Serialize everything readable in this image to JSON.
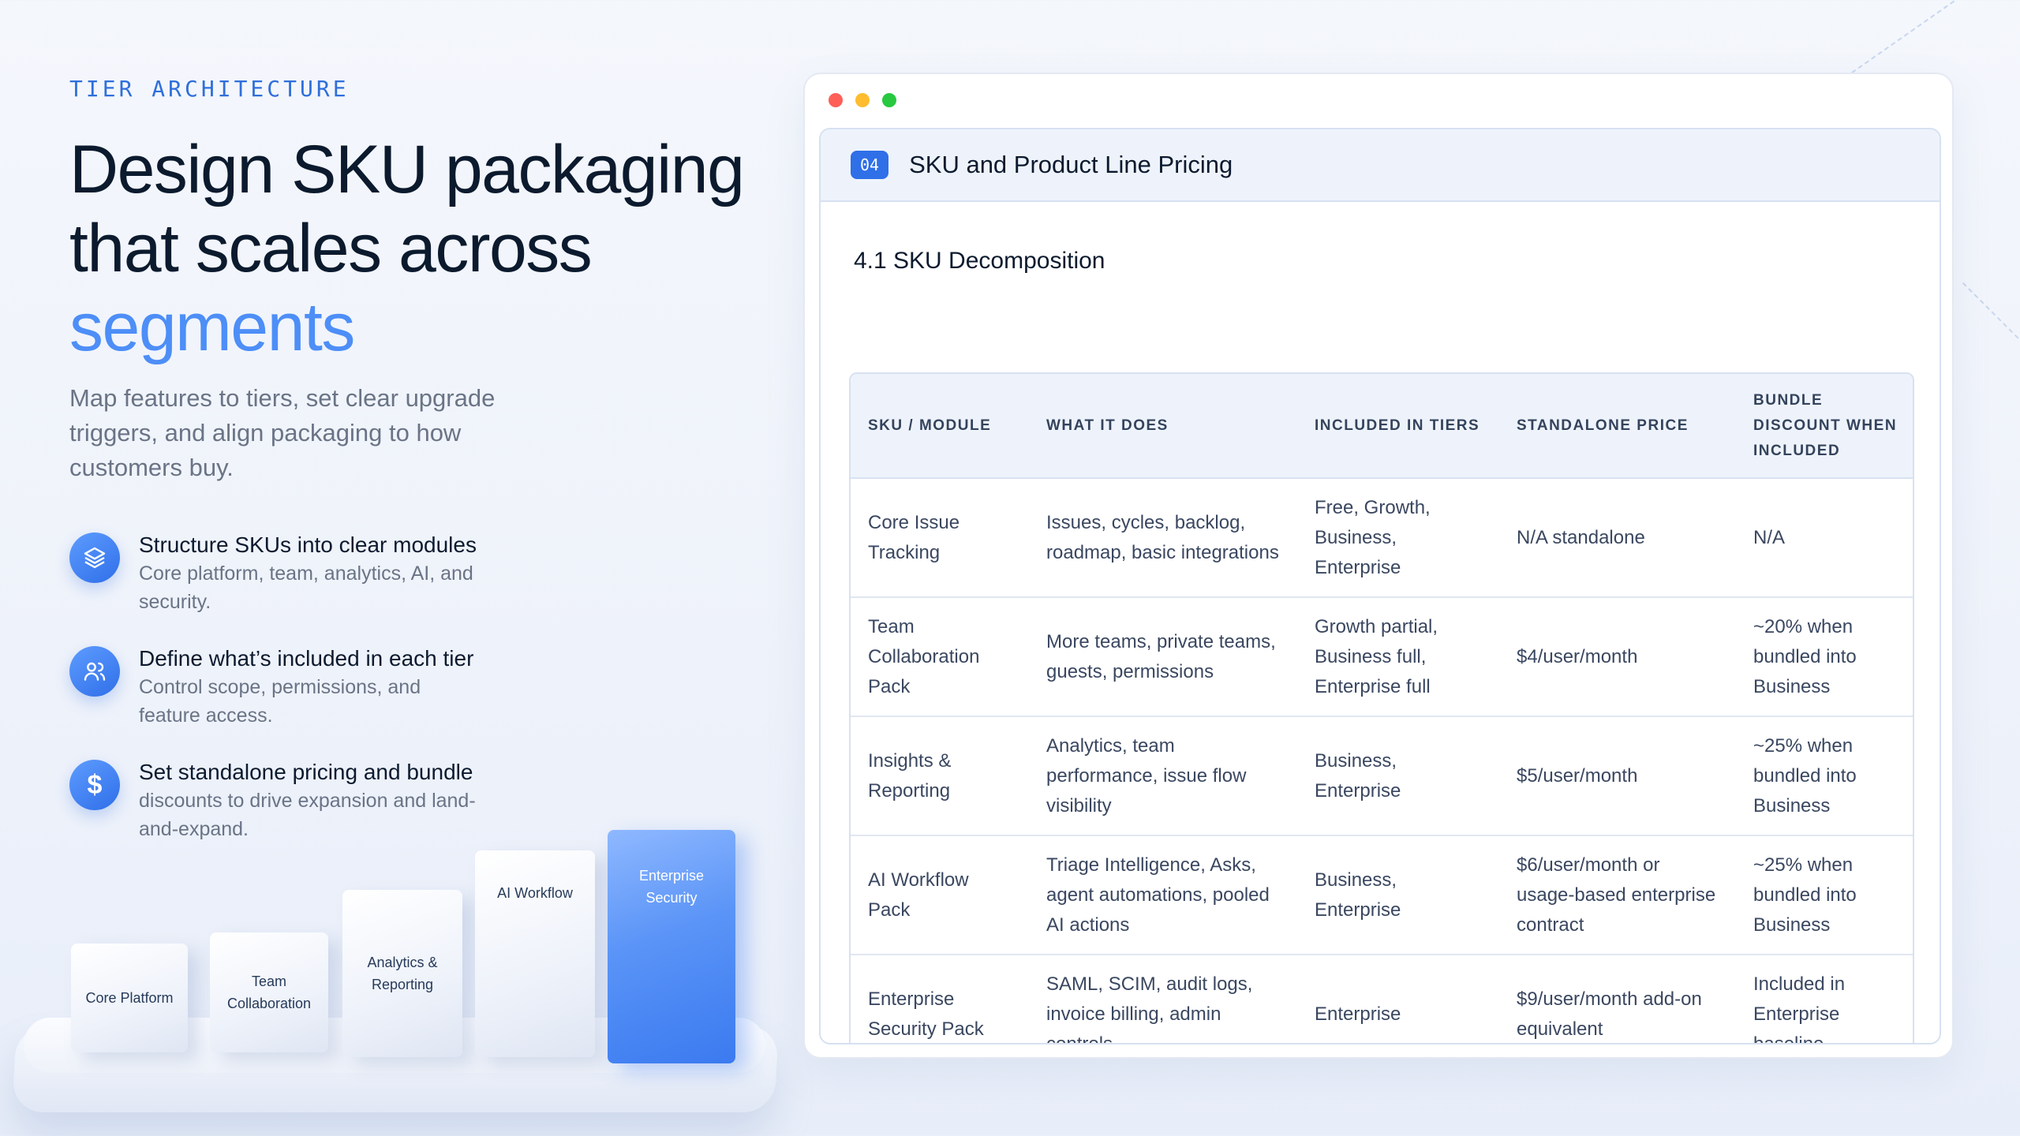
{
  "hero": {
    "eyebrow": "TIER ARCHITECTURE",
    "headline_line1": "Design SKU packaging",
    "headline_line2": "that scales across",
    "headline_accent": "segments",
    "subhead": "Map features to tiers, set clear upgrade triggers, and align packaging to how customers buy."
  },
  "features": [
    {
      "icon": "layers-icon",
      "title": "Structure SKUs into clear modules",
      "desc": "Core platform, team, analytics, AI, and security."
    },
    {
      "icon": "users-icon",
      "title": "Define what’s included in each tier",
      "desc": "Control scope, permissions, and feature access."
    },
    {
      "icon": "dollar-icon",
      "symbol": "$",
      "title": "Set standalone pricing and bundle",
      "desc": "discounts to drive expansion and land-and-expand."
    }
  ],
  "blocks": [
    "Core Platform",
    "Team Collaboration",
    "Analytics & Reporting",
    "AI Workflow",
    "Enterprise Security"
  ],
  "window": {
    "badge": "04",
    "title": "SKU and Product Line Pricing",
    "section": "4.1 SKU Decomposition",
    "dot_colors": [
      "#ff5f57",
      "#febc2e",
      "#28c840"
    ],
    "columns": [
      "SKU / MODULE",
      "WHAT IT DOES",
      "INCLUDED IN TIERS",
      "STANDALONE PRICE",
      "BUNDLE DISCOUNT WHEN INCLUDED"
    ],
    "rows": [
      [
        "Core Issue Tracking",
        "Issues, cycles, backlog, roadmap, basic integrations",
        "Free, Growth, Business, Enterprise",
        "N/A standalone",
        "N/A"
      ],
      [
        "Team Collaboration Pack",
        "More teams, private teams, guests, permissions",
        "Growth partial, Business full, Enterprise full",
        "$4/user/month",
        "~20% when bundled into Business"
      ],
      [
        "Insights & Reporting",
        "Analytics, team performance, issue flow visibility",
        "Business, Enterprise",
        "$5/user/month",
        "~25% when bundled into Business"
      ],
      [
        "AI Workflow Pack",
        "Triage Intelligence, Asks, agent automations, pooled AI actions",
        "Business, Enterprise",
        "$6/user/month or usage-based enterprise contract",
        "~25% when bundled into Business"
      ],
      [
        "Enterprise Security Pack",
        "SAML, SCIM, audit logs, invoice billing, admin controls",
        "Enterprise",
        "$9/user/month add-on equivalent",
        "Included in Enterprise baseline"
      ]
    ]
  },
  "colors": {
    "accent": "#4d8ef7",
    "brand": "#2f6fe8",
    "eyebrow": "#2f6fdb"
  }
}
